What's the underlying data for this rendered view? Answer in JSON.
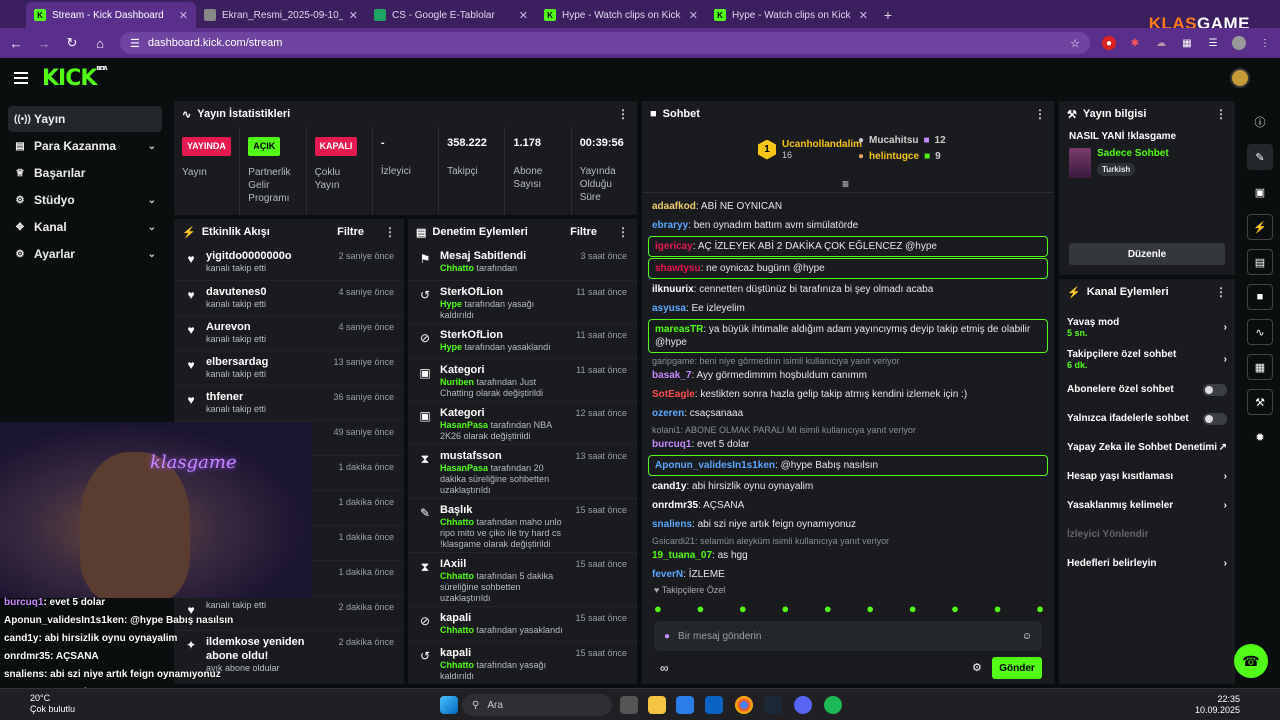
{
  "browser": {
    "tabs": [
      {
        "title": "Stream - Kick Dashboard",
        "fav": "K",
        "color": "#53fc18"
      },
      {
        "title": "Ekran_Resmi_2025-09-10_21.2…",
        "fav": "",
        "color": "#888888"
      },
      {
        "title": "CS - Google E-Tablolar",
        "fav": "",
        "color": "#1fa463"
      },
      {
        "title": "Hype - Watch clips on Kick",
        "fav": "K",
        "color": "#53fc18"
      },
      {
        "title": "Hype - Watch clips on Kick",
        "fav": "K",
        "color": "#53fc18"
      }
    ],
    "url": "dashboard.kick.com/stream",
    "brand_a": "KLAS",
    "brand_b": "GAME"
  },
  "kick": {
    "logo": "KICK",
    "logo_sup": "BETA"
  },
  "sidebar": {
    "items": [
      {
        "label": "Yayın",
        "icon": "((•))"
      },
      {
        "label": "Para Kazanma",
        "icon": "▤"
      },
      {
        "label": "Başarılar",
        "icon": "♕"
      },
      {
        "label": "Stüdyo",
        "icon": "⚙"
      },
      {
        "label": "Kanal",
        "icon": "✥"
      },
      {
        "label": "Ayarlar",
        "icon": "⚙"
      }
    ]
  },
  "stats": {
    "title": "Yayın İstatistikleri",
    "cols": [
      {
        "badge": "YAYINDA",
        "badge_bg": "#e3194f",
        "badge_fg": "#ffffff",
        "label": "Yayın"
      },
      {
        "badge": "AÇIK",
        "badge_bg": "#53fc18",
        "badge_fg": "#000000",
        "label": "Partnerlik Gelir Programı"
      },
      {
        "badge": "KAPALI",
        "badge_bg": "#e3194f",
        "badge_fg": "#ffffff",
        "label": "Çoklu Yayın"
      },
      {
        "value": "-",
        "label": "İzleyici"
      },
      {
        "value": "358.222",
        "label": "Takipçi"
      },
      {
        "value": "1.178",
        "label": "Abone Sayısı"
      },
      {
        "value": "00:39:56",
        "label": "Yayında Olduğu Süre"
      }
    ]
  },
  "activity": {
    "title": "Etkinlik Akışı",
    "filter": "Filtre",
    "items": [
      {
        "name": "yigitdo0000000o",
        "desc": "kanalı takip etti",
        "time": "2 saniye önce"
      },
      {
        "name": "davutenes0",
        "desc": "kanalı takip etti",
        "time": "4 saniye önce"
      },
      {
        "name": "Aurevon",
        "desc": "kanalı takip etti",
        "time": "4 saniye önce"
      },
      {
        "name": "elbersardag",
        "desc": "kanalı takip etti",
        "time": "13 saniye önce"
      },
      {
        "name": "thfener",
        "desc": "kanalı takip etti",
        "time": "36 saniye önce"
      },
      {
        "name": "",
        "desc": "",
        "time": "49 saniye önce"
      },
      {
        "name": "",
        "desc": "",
        "time": "1 dakika önce"
      },
      {
        "name": "",
        "desc": "",
        "time": "1 dakika önce"
      },
      {
        "name": "",
        "desc": "",
        "time": "1 dakika önce"
      },
      {
        "name": "",
        "desc": "",
        "time": "1 dakika önce"
      },
      {
        "name": "",
        "desc": "kanalı takip etti",
        "time": "2 dakika önce"
      },
      {
        "name": "ildemkose yeniden abone oldu!",
        "desc": "ayık abone oldular",
        "time": "2 dakika önce"
      }
    ]
  },
  "moderation": {
    "title": "Denetim Eylemleri",
    "filter": "Filtre",
    "items": [
      {
        "icon": "⚑",
        "name": "Mesaj Sabitlendi",
        "actor": "Chhatto",
        "rest": "tarafından",
        "time": "3 saat önce"
      },
      {
        "icon": "↺",
        "name": "SterkOfLion",
        "actor": "Hype",
        "rest": "tarafından yasağı kaldırıldı",
        "time": "11 saat önce"
      },
      {
        "icon": "⊘",
        "name": "SterkOfLion",
        "actor": "Hype",
        "rest": "tarafından yasaklandı",
        "time": "11 saat önce"
      },
      {
        "icon": "▣",
        "name": "Kategori",
        "actor": "Nuriben",
        "rest": "tarafından Just Chatting olarak değiştirildi",
        "time": "11 saat önce"
      },
      {
        "icon": "▣",
        "name": "Kategori",
        "actor": "HasanPasa",
        "rest": "tarafından NBA 2K26 olarak değiştirildi",
        "time": "12 saat önce"
      },
      {
        "icon": "⧗",
        "name": "mustafsson",
        "actor": "HasanPasa",
        "rest": "tarafından 20 dakika süreliğine sohbetten uzaklaştırıldı",
        "time": "13 saat önce"
      },
      {
        "icon": "✎",
        "name": "Başlık",
        "actor": "Chhatto",
        "rest": "tarafından maho unlo ripo mito ve çiko ile try hard cs !klasgame olarak değiştirildi",
        "time": "15 saat önce"
      },
      {
        "icon": "⧗",
        "name": "IAxiil",
        "actor": "Chhatto",
        "rest": "tarafından 5 dakika süreliğine sohbetten uzaklaştırıldı",
        "time": "15 saat önce"
      },
      {
        "icon": "⊘",
        "name": "kapali",
        "actor": "Chhatto",
        "rest": "tarafından yasaklandı",
        "time": "15 saat önce"
      },
      {
        "icon": "↺",
        "name": "kapali",
        "actor": "Chhatto",
        "rest": "tarafından yasağı kaldırıldı",
        "time": "15 saat önce"
      },
      {
        "icon": "⊘",
        "name": "kapali",
        "actor": "",
        "rest": "",
        "time": "15 saat önce"
      }
    ]
  },
  "chat": {
    "title": "Sohbet",
    "top": [
      {
        "rank": "1",
        "name": "Ucanhollandalim",
        "count": "16",
        "color": "#f5c518"
      },
      {
        "name": "Mucahitsu",
        "count": "12",
        "color": "#cfcfcf"
      },
      {
        "name": "helintugce",
        "count": "9",
        "color": "#e8a060"
      }
    ],
    "messages": [
      {
        "user": "adaafkod",
        "color": "#f0d070",
        "text": "ABİ NE OYNICAN"
      },
      {
        "user": "ebraryy",
        "color": "#5fa8ff",
        "text": "ben oynadım battım avm simülatörde"
      },
      {
        "user": "igericay",
        "color": "#e3194f",
        "text": "AÇ İZLEYEK ABİ 2 DAKİKA ÇOK EĞLENCEZ @hype",
        "hl": true
      },
      {
        "user": "shawtysu",
        "color": "#e3194f",
        "text": "ne oynicaz bugünn @hype",
        "hl": true
      },
      {
        "user": "ilknuurix",
        "color": "#ffffff",
        "text": "cennetten düştünüz bi tarafınıza bi şey olmadı acaba"
      },
      {
        "user": "asyusa",
        "color": "#5fa8ff",
        "text": "Ee izleyelim"
      },
      {
        "user": "mareasTR",
        "color": "#53fc18",
        "text": "ya büyük ihtimalle aldığım adam yayıncıymış deyip takip etmiş de olabilir @hype",
        "hl": true
      },
      {
        "reply": "garipgame: beni niye görmedinn isimli kullanıcıya yanıt veriyor",
        "user": "basak_7",
        "color": "#c88bff",
        "text": "Ayy görmedimmm hoşbuldum canımm"
      },
      {
        "user": "SotEagle",
        "color": "#ff4d4d",
        "text": "kestikten sonra hazla gelip takip atmış kendini izlemek için :)"
      },
      {
        "user": "ozeren",
        "color": "#5fa8ff",
        "text": "csaçsanaaa"
      },
      {
        "reply": "kolani1: ABONE OLMAK PARALI MI isimli kullanıcıya yanıt veriyor",
        "user": "burcuq1",
        "color": "#c88bff",
        "text": "evet 5 dolar"
      },
      {
        "user": "Aponun_validesIn1s1ken",
        "color": "#5fa8ff",
        "text": "@hype Babış nasılsın",
        "hl": true
      },
      {
        "user": "cand1y",
        "color": "#ffffff",
        "text": "abi hirsizlik oynu oynayalim"
      },
      {
        "user": "onrdmr35",
        "color": "#ffffff",
        "text": "AÇSANA"
      },
      {
        "user": "snaliens",
        "color": "#5fa8ff",
        "text": "abi szi niye artık feign oynamıyonuz"
      },
      {
        "reply": "Gsicardi21: selamün aleyküm isimli kullanıcıya yanıt veriyor",
        "user": "19_tuana_07",
        "color": "#53fc18",
        "text": "as hgg"
      },
      {
        "user": "feverN",
        "color": "#5fa8ff",
        "text": "İZLEME"
      }
    ],
    "followers_only": "Takipçilere Özel",
    "placeholder": "Bir mesaj gönderin",
    "send": "Gönder"
  },
  "streaminfo": {
    "title": "Yayın bilgisi",
    "stream_title": "NASIL YANİ !klasgame",
    "category": "Sadece Sohbet",
    "tag": "Turkish",
    "edit": "Düzenle"
  },
  "channel_actions": {
    "title": "Kanal Eylemleri",
    "items": [
      {
        "label": "Yavaş mod",
        "sub": "5 sn.",
        "ctl": "chev"
      },
      {
        "label": "Takipçilere özel sohbet",
        "sub": "6 dk.",
        "ctl": "chev"
      },
      {
        "label": "Abonelere özel sohbet",
        "ctl": "toggle"
      },
      {
        "label": "Yalnızca ifadelerle sohbet",
        "ctl": "toggle"
      },
      {
        "label": "Yapay Zeka ile Sohbet Denetimi",
        "ctl": "ext"
      },
      {
        "label": "Hesap yaşı kısıtlaması",
        "ctl": "chev"
      },
      {
        "label": "Yasaklanmış kelimeler",
        "ctl": "chev"
      },
      {
        "label": "İzleyici Yönlendir",
        "ctl": "none",
        "dim": true
      },
      {
        "label": "Hedefleri belirleyin",
        "ctl": "chev"
      }
    ]
  },
  "overlay": [
    {
      "user": "burcuq1",
      "text": ": evet 5 dolar"
    },
    {
      "user": "Aponun_validesIn1s1ken",
      "text": ": @hype Babış nasılsın"
    },
    {
      "user": "cand1y",
      "text": ": abi hirsizlik oynu oynayalim"
    },
    {
      "user": "onrdmr35",
      "text": ": AÇSANA"
    },
    {
      "user": "snaliens",
      "text": ": abi szi niye artık feign oynamıyonuz"
    },
    {
      "user": "19_tuana_07",
      "text": ": as hgg"
    },
    {
      "user": "İZLEME",
      "text": ""
    }
  ],
  "webcam_neon": "klasgame",
  "taskbar": {
    "search": "Ara",
    "time": "22:35",
    "date": "10.09.2025",
    "temp": "20°C",
    "weather": "Çok bulutlu"
  }
}
